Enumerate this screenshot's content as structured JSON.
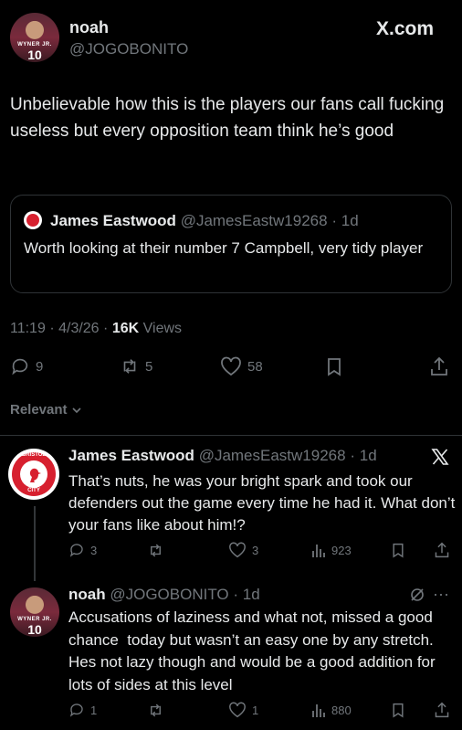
{
  "post": {
    "author_name": "noah",
    "author_handle": "@JOGOBONITO",
    "avatar_shirt_name": "WYNER JR.",
    "avatar_shirt_number": "10",
    "site_label": "X.com",
    "text": "Unbelievable how this is the players our fans call fucking useless but every opposition team think he’s good",
    "quoted": {
      "author_name": "James Eastwood",
      "author_handle": "@JamesEastw19268",
      "separator": "·",
      "age": "1d",
      "text": "Worth looking at their number 7 Campbell, very tidy player"
    },
    "meta_time": "11:19",
    "meta_sep": "·",
    "meta_date": "4/3/26",
    "meta_views_count": "16K",
    "meta_views_label": "Views",
    "stats": {
      "replies": "9",
      "reposts": "5",
      "likes": "58"
    }
  },
  "sort": {
    "label": "Relevant"
  },
  "replies": [
    {
      "author_name": "James Eastwood",
      "author_handle": "@JamesEastw19268",
      "separator": "·",
      "age": "1d",
      "crest_top": "BRISTOL",
      "crest_bottom": "CITY",
      "text": "That’s nuts, he was your bright spark and took our defenders out the game every time he had it. What don’t your fans like about him!?",
      "stats": {
        "replies": "3",
        "likes": "3",
        "views": "923"
      }
    },
    {
      "author_name": "noah",
      "author_handle": "@JOGOBONITO",
      "separator": "·",
      "age": "1d",
      "more": "···",
      "avatar_shirt_name": "WYNER JR.",
      "avatar_shirt_number": "10",
      "text": "Accusations of laziness and what not, missed a good chance  today but wasn’t an easy one by any stretch. Hes not lazy though and would be a good addition for lots of sides at this level",
      "stats": {
        "replies": "1",
        "likes": "1",
        "views": "880"
      }
    }
  ],
  "colors": {
    "background": "#000000",
    "text": "#e7e9ea",
    "secondary": "#71767b",
    "bristol_red": "#d7202f"
  }
}
